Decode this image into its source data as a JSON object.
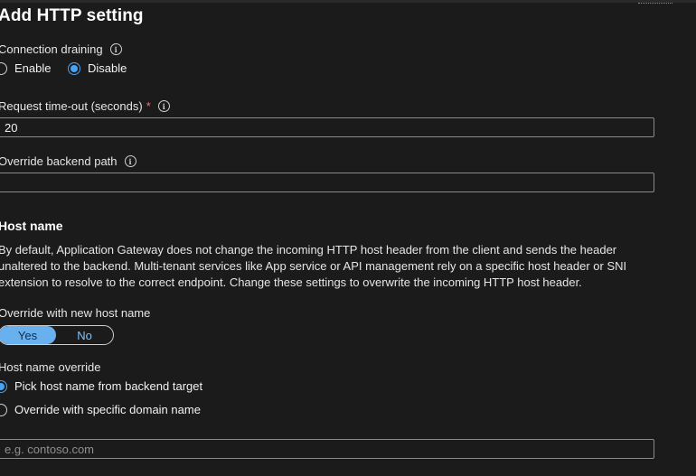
{
  "form": {
    "title": "Add HTTP setting",
    "connection_draining": {
      "label": "Connection draining",
      "options": [
        "Enable",
        "Disable"
      ],
      "selected": "Disable"
    },
    "request_timeout": {
      "label": "Request time-out (seconds)",
      "required_mark": "*",
      "value": "20"
    },
    "override_backend_path": {
      "label": "Override backend path",
      "value": ""
    },
    "host_name": {
      "heading": "Host name",
      "description": "By default, Application Gateway does not change the incoming HTTP host header from the client and sends the header unaltered to the backend. Multi-tenant services like App service or API management rely on a specific host header or SNI extension to resolve to the correct endpoint. Change these settings to overwrite the incoming HTTP host header.",
      "override_with_new_host_name": {
        "label": "Override with new host name",
        "options": [
          "Yes",
          "No"
        ],
        "selected": "Yes"
      },
      "host_name_override": {
        "label": "Host name override",
        "options": [
          "Pick host name from backend target",
          "Override with specific domain name"
        ],
        "selected": "Pick host name from backend target"
      },
      "domain_name": {
        "placeholder": "e.g. contoso.com",
        "value": ""
      }
    }
  },
  "theme": {
    "background": "#1b1b1b",
    "accent": "#4aa3f0",
    "toggle_selected": "#69b0ee",
    "required": "#f1707b"
  },
  "icons": {
    "info": "info-icon"
  }
}
